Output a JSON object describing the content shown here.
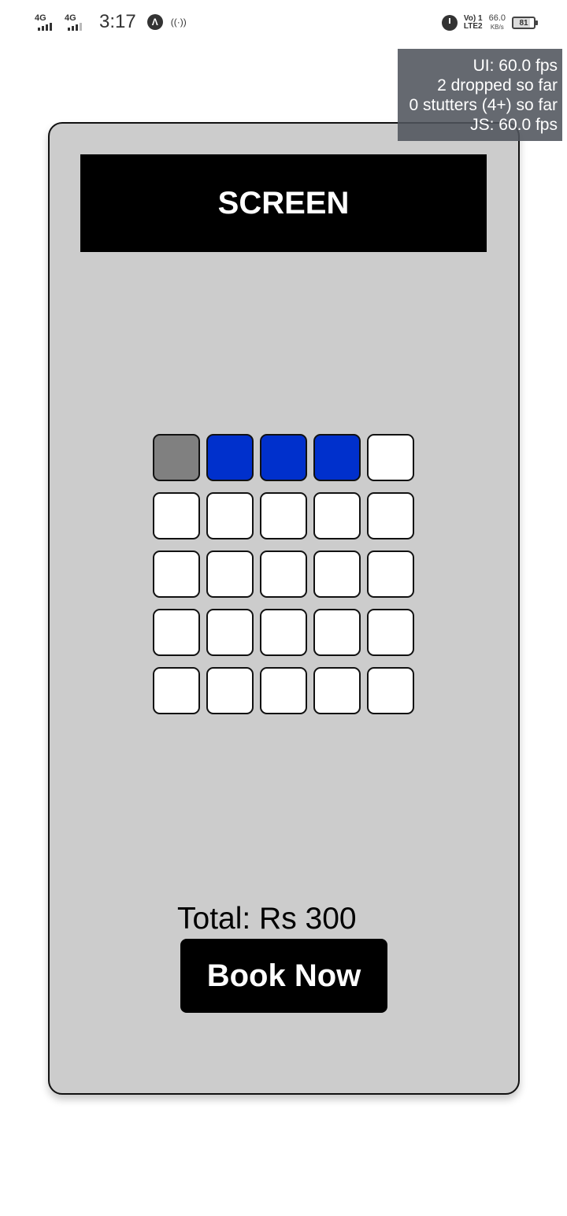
{
  "status_bar": {
    "network1": "4G",
    "network2": "4G",
    "time": "3:17",
    "volte_top": "Vo) 1",
    "volte_bottom": "LTE2",
    "speed_value": "66.0",
    "speed_unit": "KB/s",
    "battery": "81"
  },
  "perf_monitor": {
    "ui_fps": "UI: 60.0 fps",
    "dropped": "2 dropped so far",
    "stutters": "0 stutters (4+) so far",
    "js_fps": "JS: 60.0 fps"
  },
  "screen_label": "SCREEN",
  "seats": [
    [
      "occupied",
      "selected",
      "selected",
      "selected",
      "available"
    ],
    [
      "available",
      "available",
      "available",
      "available",
      "available"
    ],
    [
      "available",
      "available",
      "available",
      "available",
      "available"
    ],
    [
      "available",
      "available",
      "available",
      "available",
      "available"
    ],
    [
      "available",
      "available",
      "available",
      "available",
      "available"
    ]
  ],
  "seat_colors": {
    "available": "#ffffff",
    "occupied": "#808080",
    "selected": "#0030cc"
  },
  "total_text": "Total: Rs 300",
  "book_button": "Book Now"
}
